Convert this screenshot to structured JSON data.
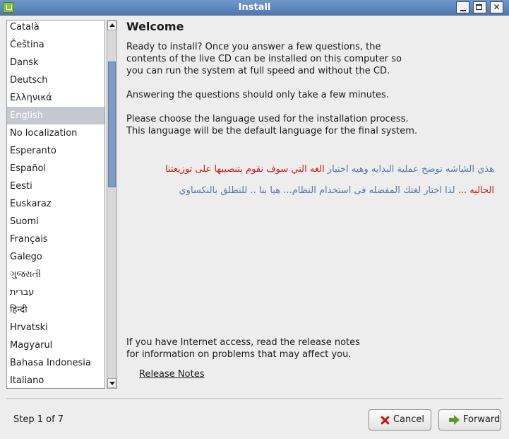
{
  "window": {
    "title": "Install"
  },
  "languages": {
    "items": [
      "Català",
      "Čeština",
      "Dansk",
      "Deutsch",
      "Ελληνικά",
      "English",
      "No localization",
      "Esperanto",
      "Español",
      "Eesti",
      "Euskaraz",
      "Suomi",
      "Français",
      "Galego",
      "ગુજરાતી",
      "עברית",
      "हिन्दी",
      "Hrvatski",
      "Magyarul",
      "Bahasa Indonesia",
      "Italiano"
    ],
    "selected": "English"
  },
  "welcome": {
    "heading": "Welcome",
    "para1": "Ready to install? Once you answer a few questions, the\ncontents of the live CD can be installed on this computer so\nyou can run the system at full speed and without the CD.",
    "para2": "Answering the questions should only take a few minutes.",
    "para3": "Please choose the language used for the installation process.\nThis language will be the default language for the final system.",
    "arabic": {
      "line1_blue": "هذي الشاشه توضح عملية البدايه وهيه اختيار",
      "line1_red": "الغه التي سوف نقوم بتنصيبها على توزيعتنا",
      "line2_red": "الحاليه ...",
      "line2_blue": "لذا اختار لغتك المفضله فى استخدام النظام... هيا بنا .. للنطلق بالنكساوي"
    },
    "para4": "If you have Internet access, read the release notes\nfor information on problems that may affect you.",
    "release_notes_label": "Release Notes"
  },
  "footer": {
    "step_text": "Step 1 of 7",
    "cancel_label": "Cancel",
    "forward_label": "Forward"
  },
  "colors": {
    "titlebar": "#5b84b8",
    "selection": "#c4c9cf",
    "arabic_blue": "#5a78a8",
    "arabic_red": "#d41818"
  },
  "icons": {
    "cancel": "x-icon",
    "forward": "forward-arrow-icon"
  }
}
